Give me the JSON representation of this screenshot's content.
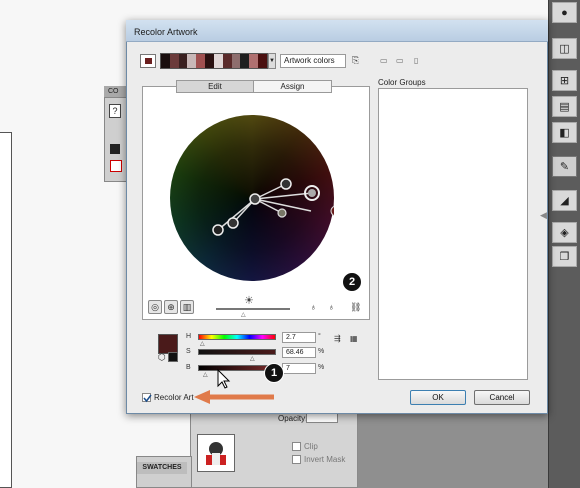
{
  "dialog": {
    "title": "Recolor Artwork",
    "preset_field": "Artwork colors",
    "tabs": {
      "edit": "Edit",
      "assign": "Assign"
    },
    "color_groups_label": "Color Groups",
    "hsb": [
      {
        "label": "H",
        "value": "2.7",
        "unit": "°"
      },
      {
        "label": "S",
        "value": "68.46",
        "unit": "%"
      },
      {
        "label": "B",
        "value": "7",
        "unit": "%"
      }
    ],
    "recolor_art_label": "Recolor Art",
    "recolor_art_checked": true,
    "ok_label": "OK",
    "cancel_label": "Cancel"
  },
  "color_strip": [
    "#1a0f0f",
    "#6b3a3a",
    "#3a2020",
    "#c9b8b8",
    "#a05050",
    "#2a1010",
    "#e0d6d6",
    "#5a2a2a",
    "#8e6e6e",
    "#1f1f1f",
    "#b07070",
    "#4a0f0f"
  ],
  "callouts": {
    "one": "1",
    "two": "2"
  },
  "background_panels": {
    "color_panel_title": "CO",
    "swatches_title": "SWATCHES",
    "opacity_label": "Opacity:",
    "clip_label": "Clip",
    "invert_mask_label": "Invert Mask"
  },
  "icons": {
    "save": "save-color-group-icon",
    "brightness": "sun-icon",
    "link": "link-icon",
    "arrow": "pointer-arrow-icon"
  },
  "accent_colors": {
    "selected_swatch": "#4a1a1a",
    "arrow": "#e07a4a",
    "dialog_border": "#6d8aa6"
  }
}
